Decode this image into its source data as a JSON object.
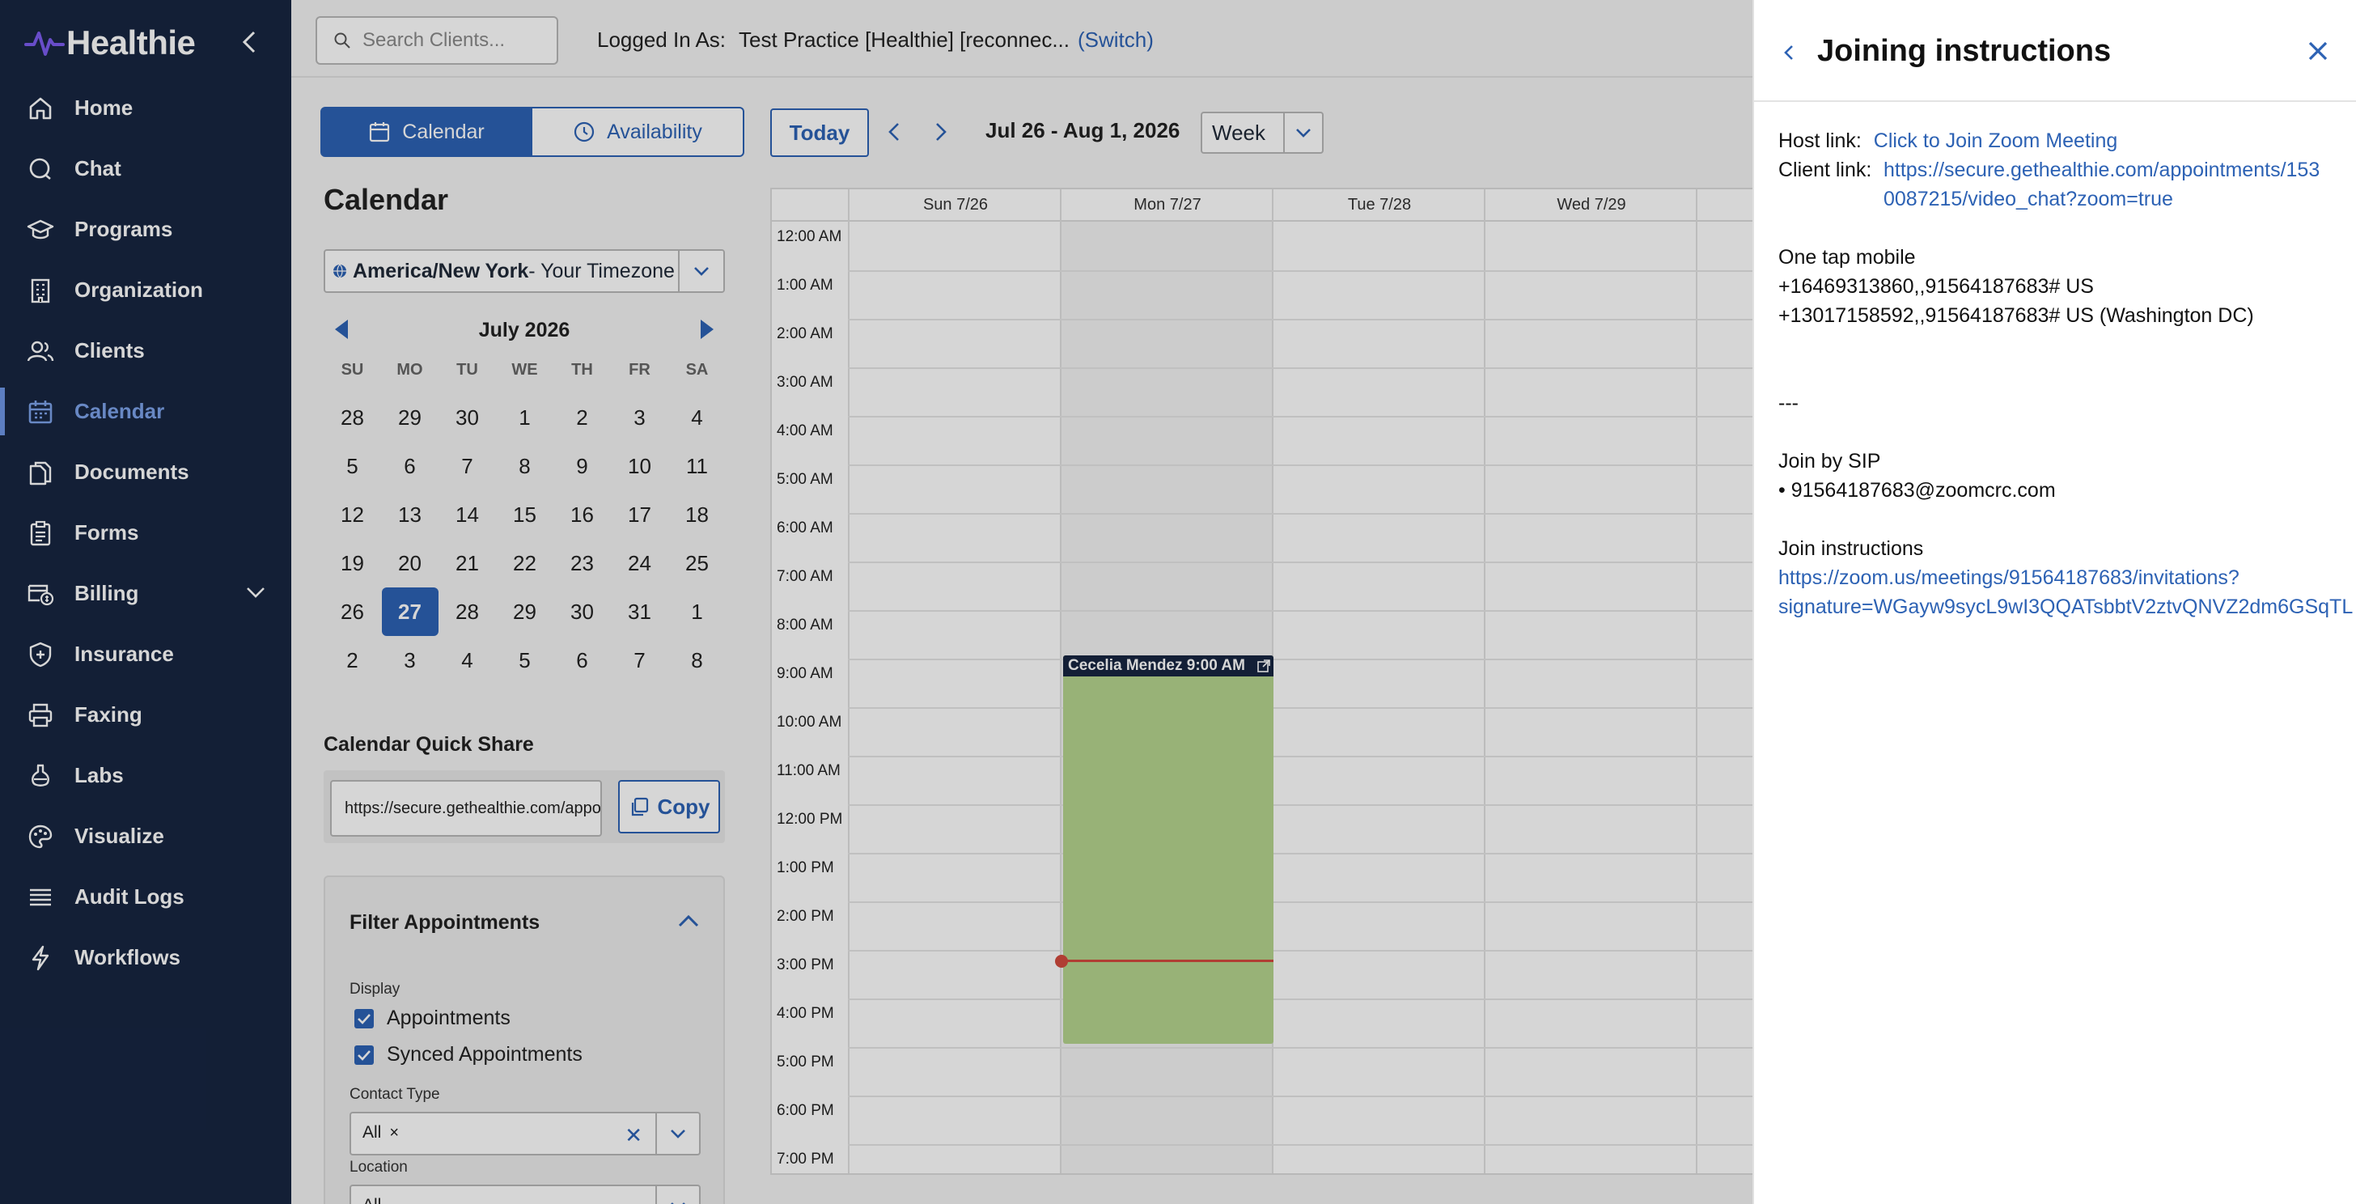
{
  "sidebar": {
    "brand": "Healthie",
    "items": [
      {
        "label": "Home",
        "icon": "home-icon"
      },
      {
        "label": "Chat",
        "icon": "chat-icon"
      },
      {
        "label": "Programs",
        "icon": "graduation-cap-icon"
      },
      {
        "label": "Organization",
        "icon": "building-icon"
      },
      {
        "label": "Clients",
        "icon": "users-icon"
      },
      {
        "label": "Calendar",
        "icon": "calendar-icon",
        "active": true
      },
      {
        "label": "Documents",
        "icon": "documents-icon"
      },
      {
        "label": "Forms",
        "icon": "clipboard-icon"
      },
      {
        "label": "Billing",
        "icon": "billing-icon",
        "expandable": true
      },
      {
        "label": "Insurance",
        "icon": "shield-icon"
      },
      {
        "label": "Faxing",
        "icon": "printer-icon"
      },
      {
        "label": "Labs",
        "icon": "flask-icon"
      },
      {
        "label": "Visualize",
        "icon": "palette-icon"
      },
      {
        "label": "Audit Logs",
        "icon": "list-icon"
      },
      {
        "label": "Workflows",
        "icon": "lightning-icon"
      }
    ]
  },
  "topbar": {
    "search_placeholder": "Search Clients...",
    "logged_in_label": "Logged In As:",
    "practice_name": "Test Practice [Healthie] [reconnec...",
    "switch_label": "(Switch)"
  },
  "toolbar": {
    "calendar_tab": "Calendar",
    "availability_tab": "Availability",
    "today_label": "Today",
    "date_range": "Jul 26 - Aug 1, 2026",
    "view_value": "Week"
  },
  "left_panel": {
    "title": "Calendar",
    "timezone_bold": "America/New York",
    "timezone_rest": " - Your Timezone",
    "mini_calendar": {
      "month": "July 2026",
      "weekdays": [
        "SU",
        "MO",
        "TU",
        "WE",
        "TH",
        "FR",
        "SA"
      ],
      "weeks": [
        [
          "28",
          "29",
          "30",
          "1",
          "2",
          "3",
          "4"
        ],
        [
          "5",
          "6",
          "7",
          "8",
          "9",
          "10",
          "11"
        ],
        [
          "12",
          "13",
          "14",
          "15",
          "16",
          "17",
          "18"
        ],
        [
          "19",
          "20",
          "21",
          "22",
          "23",
          "24",
          "25"
        ],
        [
          "26",
          "27",
          "28",
          "29",
          "30",
          "31",
          "1"
        ],
        [
          "2",
          "3",
          "4",
          "5",
          "6",
          "7",
          "8"
        ]
      ],
      "selected": "27"
    },
    "quick_share": {
      "title": "Calendar Quick Share",
      "url": "https://secure.gethealthie.com/appointments",
      "copy_label": "Copy"
    },
    "filter": {
      "title": "Filter Appointments",
      "display_label": "Display",
      "checkboxes": [
        "Appointments",
        "Synced Appointments"
      ],
      "contact_type_label": "Contact Type",
      "contact_type_chip": "All",
      "location_label": "Location",
      "location_chip": "All"
    }
  },
  "week": {
    "columns": [
      "Sun 7/26",
      "Mon 7/27",
      "Tue 7/28",
      "Wed 7/29"
    ],
    "hours": [
      "12:00 AM",
      "1:00 AM",
      "2:00 AM",
      "3:00 AM",
      "4:00 AM",
      "5:00 AM",
      "6:00 AM",
      "7:00 AM",
      "8:00 AM",
      "9:00 AM",
      "10:00 AM",
      "11:00 AM",
      "12:00 PM",
      "1:00 PM",
      "2:00 PM",
      "3:00 PM",
      "4:00 PM",
      "5:00 PM",
      "6:00 PM",
      "7:00 PM"
    ],
    "event": {
      "title": "Cecelia Mendez 9:00 AM",
      "color": "#b6d48e"
    }
  },
  "drawer": {
    "title": "Joining instructions",
    "host_label": "Host link:",
    "host_link": "Click to Join Zoom Meeting",
    "client_label": "Client link:",
    "client_link_1": "https://secure.gethealthie.com/appointments/153",
    "client_link_2": "0087215/video_chat?zoom=true",
    "one_tap": "One tap mobile",
    "phone_1": "+16469313860,,91564187683# US",
    "phone_2": "+13017158592,,91564187683# US (Washington DC)",
    "separator": "---",
    "sip_title": "Join by SIP",
    "sip_address": "• 91564187683@zoomcrc.com",
    "instructions_title": "Join instructions",
    "instructions_link_1": "https://zoom.us/meetings/91564187683/invitations?",
    "instructions_link_2": "signature=WGayw9sycL9wI3QQATsbbtV2ztvQNVZ2dm6GSqTL"
  },
  "colors": {
    "brand": "#2d62b4",
    "sidebar_bg": "#172541",
    "active_nav": "#7da3ea",
    "now_line": "#d24a3d"
  }
}
